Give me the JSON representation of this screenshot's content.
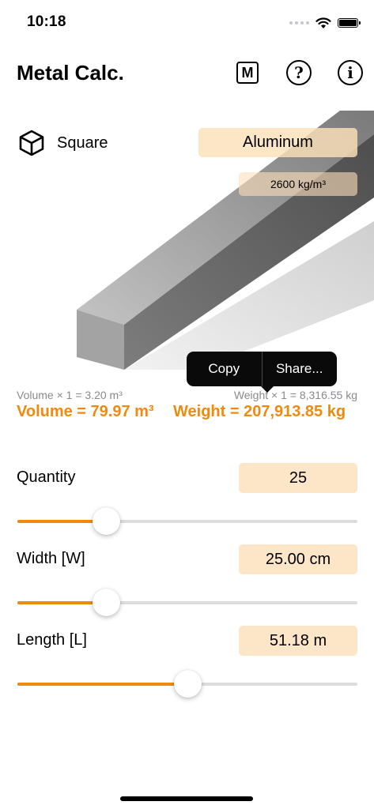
{
  "status_bar": {
    "time": "10:18"
  },
  "header": {
    "title": "Metal Calc.",
    "m_button_label": "M",
    "help_icon_label": "?",
    "info_icon_label": "i"
  },
  "shape": {
    "label": "Square",
    "icon": "cube-icon"
  },
  "material": {
    "name": "Aluminum",
    "density": "2600 kg/m³"
  },
  "popup": {
    "copy_label": "Copy",
    "share_label": "Share..."
  },
  "results": {
    "volume_single": "Volume × 1 = 3.20 m³",
    "weight_single": "Weight × 1 = 8,316.55 kg",
    "volume_total": "Volume = 79.97 m³",
    "weight_total": "Weight = 207,913.85 kg"
  },
  "params": [
    {
      "label": "Quantity",
      "value": "25",
      "slider_fraction": 0.26
    },
    {
      "label": "Width [W]",
      "value": "25.00 cm",
      "slider_fraction": 0.26
    },
    {
      "label": "Length [L]",
      "value": "51.18 m",
      "slider_fraction": 0.5
    }
  ],
  "colors": {
    "accent": "#f08a0f",
    "value_bg": "#fde5c7"
  }
}
